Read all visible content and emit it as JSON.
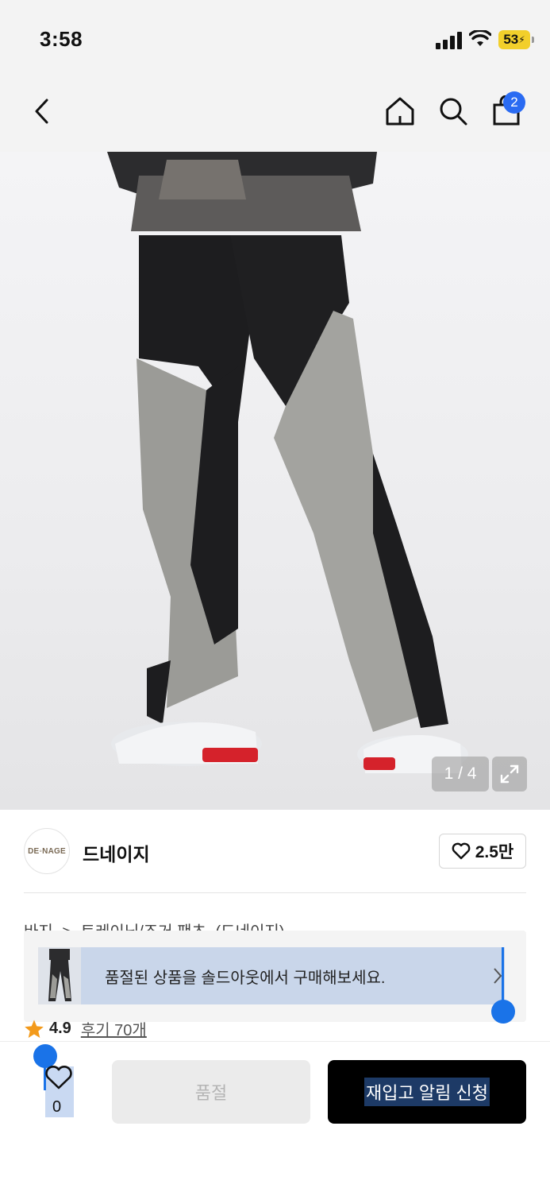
{
  "status": {
    "time": "3:58",
    "battery": "53"
  },
  "nav": {
    "cart_count": "2"
  },
  "gallery": {
    "counter": "1 / 4"
  },
  "brand": {
    "logo_text": "DE◦NAGE",
    "name": "드네이지",
    "likes": "2.5만"
  },
  "breadcrumb": {
    "items": [
      "바지",
      ">",
      "트레이닝/조거 팬츠",
      "(드네이지)"
    ]
  },
  "banner": {
    "text": "품절된 상품을 솔드아웃에서 구매해보세요."
  },
  "rating": {
    "score": "4.9",
    "reviews": "후기 70개"
  },
  "bottom_bar": {
    "wish_count": "0",
    "soldout_label": "품절",
    "restock_label": "재입고 알림 신청"
  },
  "colors": {
    "accent": "#2a6bf2",
    "star": "#f39a1b",
    "selection": "#1a73e8"
  }
}
